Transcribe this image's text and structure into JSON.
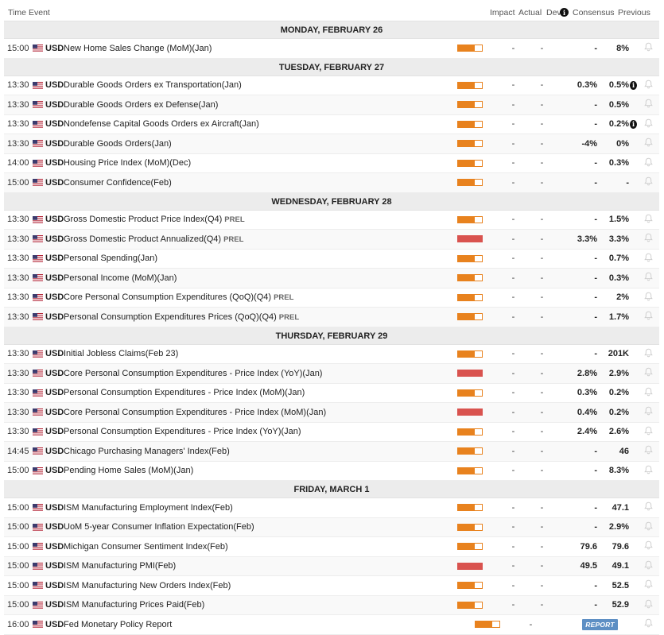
{
  "header": {
    "time": "Time",
    "event": "Event",
    "impact": "Impact",
    "actual": "Actual",
    "dev": "Dev",
    "consensus": "Consensus",
    "previous": "Previous"
  },
  "colors": {
    "medium_impact": "#e8821e",
    "high_impact": "#d9534f",
    "report_badge": "#5d8fc4"
  },
  "days": [
    {
      "label": "MONDAY, FEBRUARY 26",
      "events": [
        {
          "time": "15:00",
          "currency": "USD",
          "name": "New Home Sales Change (MoM)(Jan)",
          "prel": "",
          "impact": "medium",
          "actual": "-",
          "dev": "-",
          "consensus": "-",
          "previous": "8%",
          "info": false
        }
      ]
    },
    {
      "label": "TUESDAY, FEBRUARY 27",
      "events": [
        {
          "time": "13:30",
          "currency": "USD",
          "name": "Durable Goods Orders ex Transportation(Jan)",
          "prel": "",
          "impact": "medium",
          "actual": "-",
          "dev": "-",
          "consensus": "0.3%",
          "previous": "0.5%",
          "info": true
        },
        {
          "time": "13:30",
          "currency": "USD",
          "name": "Durable Goods Orders ex Defense(Jan)",
          "prel": "",
          "impact": "medium",
          "actual": "-",
          "dev": "-",
          "consensus": "-",
          "previous": "0.5%",
          "info": false
        },
        {
          "time": "13:30",
          "currency": "USD",
          "name": "Nondefense Capital Goods Orders ex Aircraft(Jan)",
          "prel": "",
          "impact": "medium",
          "actual": "-",
          "dev": "-",
          "consensus": "-",
          "previous": "0.2%",
          "info": true
        },
        {
          "time": "13:30",
          "currency": "USD",
          "name": "Durable Goods Orders(Jan)",
          "prel": "",
          "impact": "medium",
          "actual": "-",
          "dev": "-",
          "consensus": "-4%",
          "previous": "0%",
          "info": false
        },
        {
          "time": "14:00",
          "currency": "USD",
          "name": "Housing Price Index (MoM)(Dec)",
          "prel": "",
          "impact": "medium",
          "actual": "-",
          "dev": "-",
          "consensus": "-",
          "previous": "0.3%",
          "info": false
        },
        {
          "time": "15:00",
          "currency": "USD",
          "name": "Consumer Confidence(Feb)",
          "prel": "",
          "impact": "medium",
          "actual": "-",
          "dev": "-",
          "consensus": "-",
          "previous": "-",
          "info": false
        }
      ]
    },
    {
      "label": "WEDNESDAY, FEBRUARY 28",
      "events": [
        {
          "time": "13:30",
          "currency": "USD",
          "name": "Gross Domestic Product Price Index(Q4)",
          "prel": "PREL",
          "impact": "medium",
          "actual": "-",
          "dev": "-",
          "consensus": "-",
          "previous": "1.5%",
          "info": false
        },
        {
          "time": "13:30",
          "currency": "USD",
          "name": "Gross Domestic Product Annualized(Q4)",
          "prel": "PREL",
          "impact": "high",
          "actual": "-",
          "dev": "-",
          "consensus": "3.3%",
          "previous": "3.3%",
          "info": false
        },
        {
          "time": "13:30",
          "currency": "USD",
          "name": "Personal Spending(Jan)",
          "prel": "",
          "impact": "medium",
          "actual": "-",
          "dev": "-",
          "consensus": "-",
          "previous": "0.7%",
          "info": false
        },
        {
          "time": "13:30",
          "currency": "USD",
          "name": "Personal Income (MoM)(Jan)",
          "prel": "",
          "impact": "medium",
          "actual": "-",
          "dev": "-",
          "consensus": "-",
          "previous": "0.3%",
          "info": false
        },
        {
          "time": "13:30",
          "currency": "USD",
          "name": "Core Personal Consumption Expenditures (QoQ)(Q4)",
          "prel": "PREL",
          "impact": "medium",
          "actual": "-",
          "dev": "-",
          "consensus": "-",
          "previous": "2%",
          "info": false
        },
        {
          "time": "13:30",
          "currency": "USD",
          "name": "Personal Consumption Expenditures Prices (QoQ)(Q4)",
          "prel": "PREL",
          "impact": "medium",
          "actual": "-",
          "dev": "-",
          "consensus": "-",
          "previous": "1.7%",
          "info": false
        }
      ]
    },
    {
      "label": "THURSDAY, FEBRUARY 29",
      "events": [
        {
          "time": "13:30",
          "currency": "USD",
          "name": "Initial Jobless Claims(Feb 23)",
          "prel": "",
          "impact": "medium",
          "actual": "-",
          "dev": "-",
          "consensus": "-",
          "previous": "201K",
          "info": false
        },
        {
          "time": "13:30",
          "currency": "USD",
          "name": "Core Personal Consumption Expenditures - Price Index (YoY)(Jan)",
          "prel": "",
          "impact": "high",
          "actual": "-",
          "dev": "-",
          "consensus": "2.8%",
          "previous": "2.9%",
          "info": false
        },
        {
          "time": "13:30",
          "currency": "USD",
          "name": "Personal Consumption Expenditures - Price Index (MoM)(Jan)",
          "prel": "",
          "impact": "medium",
          "actual": "-",
          "dev": "-",
          "consensus": "0.3%",
          "previous": "0.2%",
          "info": false
        },
        {
          "time": "13:30",
          "currency": "USD",
          "name": "Core Personal Consumption Expenditures - Price Index (MoM)(Jan)",
          "prel": "",
          "impact": "high",
          "actual": "-",
          "dev": "-",
          "consensus": "0.4%",
          "previous": "0.2%",
          "info": false
        },
        {
          "time": "13:30",
          "currency": "USD",
          "name": "Personal Consumption Expenditures - Price Index (YoY)(Jan)",
          "prel": "",
          "impact": "medium",
          "actual": "-",
          "dev": "-",
          "consensus": "2.4%",
          "previous": "2.6%",
          "info": false
        },
        {
          "time": "14:45",
          "currency": "USD",
          "name": "Chicago Purchasing Managers' Index(Feb)",
          "prel": "",
          "impact": "medium",
          "actual": "-",
          "dev": "-",
          "consensus": "-",
          "previous": "46",
          "info": false
        },
        {
          "time": "15:00",
          "currency": "USD",
          "name": "Pending Home Sales (MoM)(Jan)",
          "prel": "",
          "impact": "medium",
          "actual": "-",
          "dev": "-",
          "consensus": "-",
          "previous": "8.3%",
          "info": false
        }
      ]
    },
    {
      "label": "FRIDAY, MARCH 1",
      "events": [
        {
          "time": "15:00",
          "currency": "USD",
          "name": "ISM Manufacturing Employment Index(Feb)",
          "prel": "",
          "impact": "medium",
          "actual": "-",
          "dev": "-",
          "consensus": "-",
          "previous": "47.1",
          "info": false
        },
        {
          "time": "15:00",
          "currency": "USD",
          "name": "UoM 5-year Consumer Inflation Expectation(Feb)",
          "prel": "",
          "impact": "medium",
          "actual": "-",
          "dev": "-",
          "consensus": "-",
          "previous": "2.9%",
          "info": false
        },
        {
          "time": "15:00",
          "currency": "USD",
          "name": "Michigan Consumer Sentiment Index(Feb)",
          "prel": "",
          "impact": "medium",
          "actual": "-",
          "dev": "-",
          "consensus": "79.6",
          "previous": "79.6",
          "info": false
        },
        {
          "time": "15:00",
          "currency": "USD",
          "name": "ISM Manufacturing PMI(Feb)",
          "prel": "",
          "impact": "high",
          "actual": "-",
          "dev": "-",
          "consensus": "49.5",
          "previous": "49.1",
          "info": false
        },
        {
          "time": "15:00",
          "currency": "USD",
          "name": "ISM Manufacturing New Orders Index(Feb)",
          "prel": "",
          "impact": "medium",
          "actual": "-",
          "dev": "-",
          "consensus": "-",
          "previous": "52.5",
          "info": false
        },
        {
          "time": "15:00",
          "currency": "USD",
          "name": "ISM Manufacturing Prices Paid(Feb)",
          "prel": "",
          "impact": "medium",
          "actual": "-",
          "dev": "-",
          "consensus": "-",
          "previous": "52.9",
          "info": false
        },
        {
          "time": "16:00",
          "currency": "USD",
          "name": "Fed Monetary Policy Report",
          "prel": "",
          "impact": "medium",
          "actual": "-",
          "dev": "",
          "consensus": "",
          "previous": "",
          "info": false,
          "report": "REPORT"
        }
      ]
    }
  ]
}
